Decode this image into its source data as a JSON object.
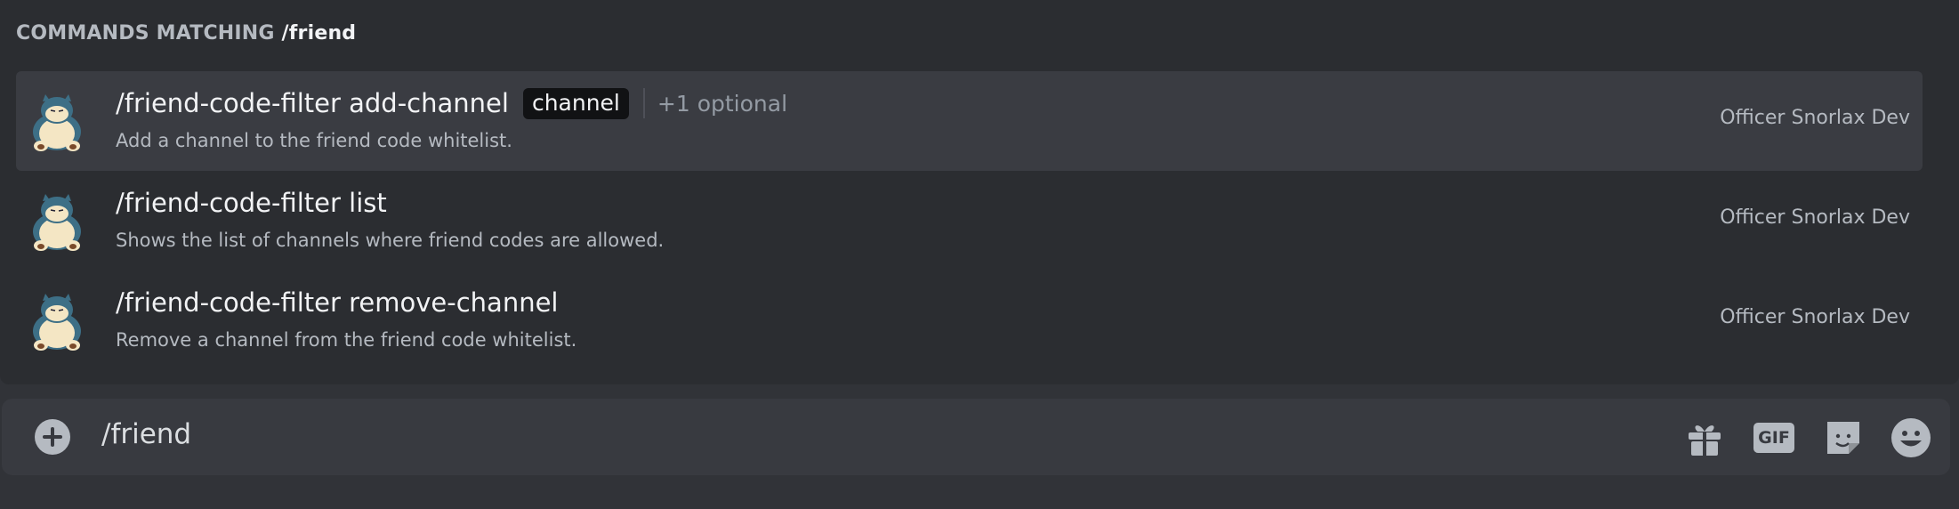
{
  "autocomplete": {
    "header_prefix": "COMMANDS MATCHING",
    "header_query": "/friend",
    "commands": [
      {
        "name": "/friend-code-filter add-channel",
        "arg": "channel",
        "optional": "+1 optional",
        "description": "Add a channel to the friend code whitelist.",
        "source": "Officer Snorlax Dev",
        "selected": true
      },
      {
        "name": "/friend-code-filter list",
        "description": "Shows the list of channels where friend codes are allowed.",
        "source": "Officer Snorlax Dev"
      },
      {
        "name": "/friend-code-filter remove-channel",
        "description": "Remove a channel from the friend code whitelist.",
        "source": "Officer Snorlax Dev"
      }
    ]
  },
  "composer": {
    "value": "/friend",
    "buttons": {
      "plus": "plus-circle-icon",
      "gift": "gift-icon",
      "gif": "GIF",
      "sticker": "sticker-icon",
      "emoji": "emoji-icon"
    }
  },
  "colors": {
    "background": "#313338",
    "popup": "#2b2d31",
    "selected_row": "#3a3c42",
    "composer": "#383a40",
    "text_primary": "#f2f3f5",
    "text_muted": "#b5bac1"
  }
}
